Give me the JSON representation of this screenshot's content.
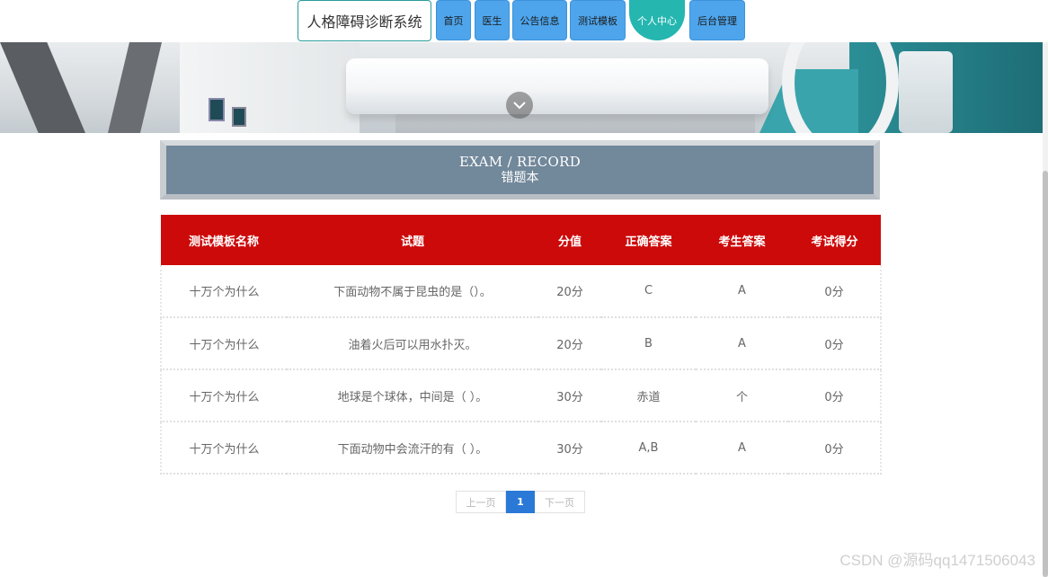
{
  "header": {
    "brand": "人格障碍诊断系统",
    "nav": [
      {
        "label": "首页",
        "active": false
      },
      {
        "label": "医生",
        "active": false
      },
      {
        "label": "公告信息",
        "active": false
      },
      {
        "label": "测试模板",
        "active": false
      },
      {
        "label": "个人中心",
        "active": true
      },
      {
        "label": "后台管理",
        "active": false
      }
    ]
  },
  "banner": {
    "scroll_icon": "chevron-down-icon"
  },
  "section": {
    "title_en": "EXAM / RECORD",
    "title_cn": "错题本"
  },
  "table": {
    "columns": [
      "测试模板名称",
      "试题",
      "分值",
      "正确答案",
      "考生答案",
      "考试得分"
    ],
    "rows": [
      [
        "十万个为什么",
        "下面动物不属于昆虫的是（）。",
        "20分",
        "C",
        "A",
        "0分"
      ],
      [
        "十万个为什么",
        "油着火后可以用水扑灭。",
        "20分",
        "B",
        "A",
        "0分"
      ],
      [
        "十万个为什么",
        "地球是个球体，中间是（ ）。",
        "30分",
        "赤道",
        "个",
        "0分"
      ],
      [
        "十万个为什么",
        "下面动物中会流汗的有（ ）。",
        "30分",
        "A,B",
        "A",
        "0分"
      ]
    ]
  },
  "pagination": {
    "prev": "上一页",
    "current": "1",
    "next": "下一页"
  },
  "watermark": "CSDN @源码qq1471506043",
  "colors": {
    "nav": "#4ea5ec",
    "nav_active": "#25b6b0",
    "table_header": "#cd0a0a",
    "section_bg": "#72889b",
    "pager_active": "#2a79d6"
  }
}
